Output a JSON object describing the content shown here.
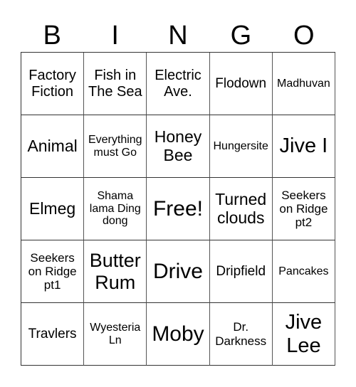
{
  "header": [
    "B",
    "I",
    "N",
    "G",
    "O"
  ],
  "cells": [
    [
      "Factory Fiction",
      "Fish in The Sea",
      "Electric Ave.",
      "Flodown",
      "Madhuvan"
    ],
    [
      "Animal",
      "Everything must Go",
      "Honey Bee",
      "Hungersite",
      "Jive I"
    ],
    [
      "Elmeg",
      "Shama lama Ding dong",
      "Free!",
      "Turned clouds",
      "Seekers on Ridge pt2"
    ],
    [
      "Seekers on Ridge pt1",
      "Butter Rum",
      "Drive",
      "Dripfield",
      "Pancakes"
    ],
    [
      "Travlers",
      "Wyesteria Ln",
      "Moby",
      "Dr. Darkness",
      "Jive Lee"
    ]
  ]
}
